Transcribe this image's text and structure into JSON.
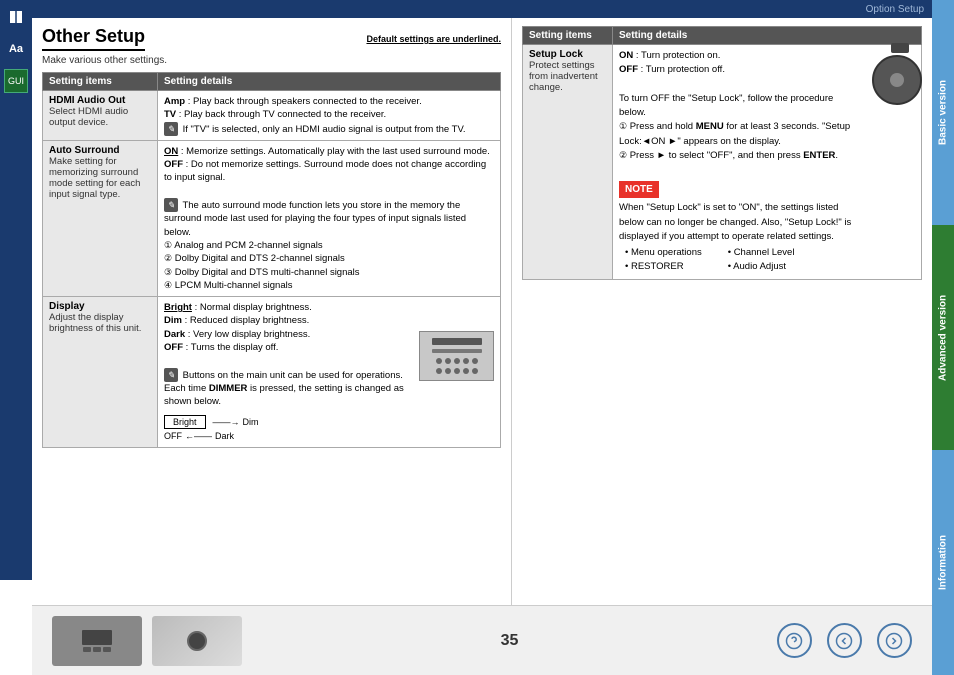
{
  "topbar": {
    "title": "Option Setup"
  },
  "sidebar_left": {
    "icons": [
      "book",
      "Aa",
      "GUI"
    ]
  },
  "sidebar_right": {
    "tabs": [
      {
        "id": "basic",
        "label": "Basic version"
      },
      {
        "id": "advanced",
        "label": "Advanced version"
      },
      {
        "id": "information",
        "label": "Information"
      }
    ]
  },
  "left_panel": {
    "title": "Other Setup",
    "default_note": "Default settings are underlined.",
    "subtitle": "Make various other settings.",
    "table_header": {
      "col1": "Setting items",
      "col2": "Setting details"
    },
    "rows": [
      {
        "id": "hdmi_audio",
        "name": "HDMI Audio Out",
        "name_desc": "Select HDMI audio output device.",
        "detail_lines": [
          "Amp : Play back through speakers connected to the receiver.",
          "TV : Play back through TV connected to the receiver.",
          "If \"TV\" is selected, only an HDMI audio signal is output from the TV."
        ]
      },
      {
        "id": "auto_surround",
        "name": "Auto Surround",
        "name_desc": "Make setting for memorizing surround mode setting for each input signal type.",
        "detail_lines": [
          "ON : Memorize settings. Automatically play with the last used surround mode.",
          "OFF : Do not memorize settings. Surround mode does not change according to input signal.",
          "The auto surround mode function lets you store in the memory the surround mode last used for playing the four types of input signals listed below.",
          "① Analog and PCM 2-channel signals",
          "② Dolby Digital and DTS 2-channel signals",
          "③ Dolby Digital and DTS multi-channel signals",
          "④ LPCM Multi-channel signals"
        ]
      },
      {
        "id": "display",
        "name": "Display",
        "name_desc": "Adjust the display brightness of this unit.",
        "detail_lines": [
          "Bright : Normal display brightness.",
          "Dim : Reduced display brightness.",
          "Dark : Very low display brightness.",
          "OFF : Turns the display off.",
          "Buttons on the main unit can be used for operations.",
          "Each time DIMMER is pressed, the setting is changed as shown below.",
          "Bright → Dim",
          "OFF ← Dark"
        ]
      }
    ]
  },
  "right_panel": {
    "table_header": {
      "col1": "Setting items",
      "col2": "Setting details"
    },
    "setup_lock": {
      "name": "Setup Lock",
      "name_desc": "Protect settings from inadvertent change.",
      "detail": {
        "on": "ON : Turn protection on.",
        "off": "OFF : Turn protection off.",
        "procedure_intro": "To turn OFF the \"Setup Lock\", follow the procedure below.",
        "step1": "① Press and hold MENU for at least 3 seconds. \"Setup Lock:◄ON ►\" appears on the display.",
        "step2": "② Press ► to select \"OFF\", and then press ENTER.",
        "note_label": "NOTE",
        "note_text": "When \"Setup Lock\" is set to \"ON\", the settings listed below can no longer be changed. Also, \"Setup Lock!\" is displayed if you attempt to operate related settings.",
        "bullets_col1": [
          "• Menu operations",
          "• RESTORER"
        ],
        "bullets_col2": [
          "• Channel Level",
          "• Audio Adjust"
        ]
      }
    }
  },
  "bottom": {
    "page_number": "35",
    "icons": [
      "help",
      "back",
      "forward"
    ]
  }
}
